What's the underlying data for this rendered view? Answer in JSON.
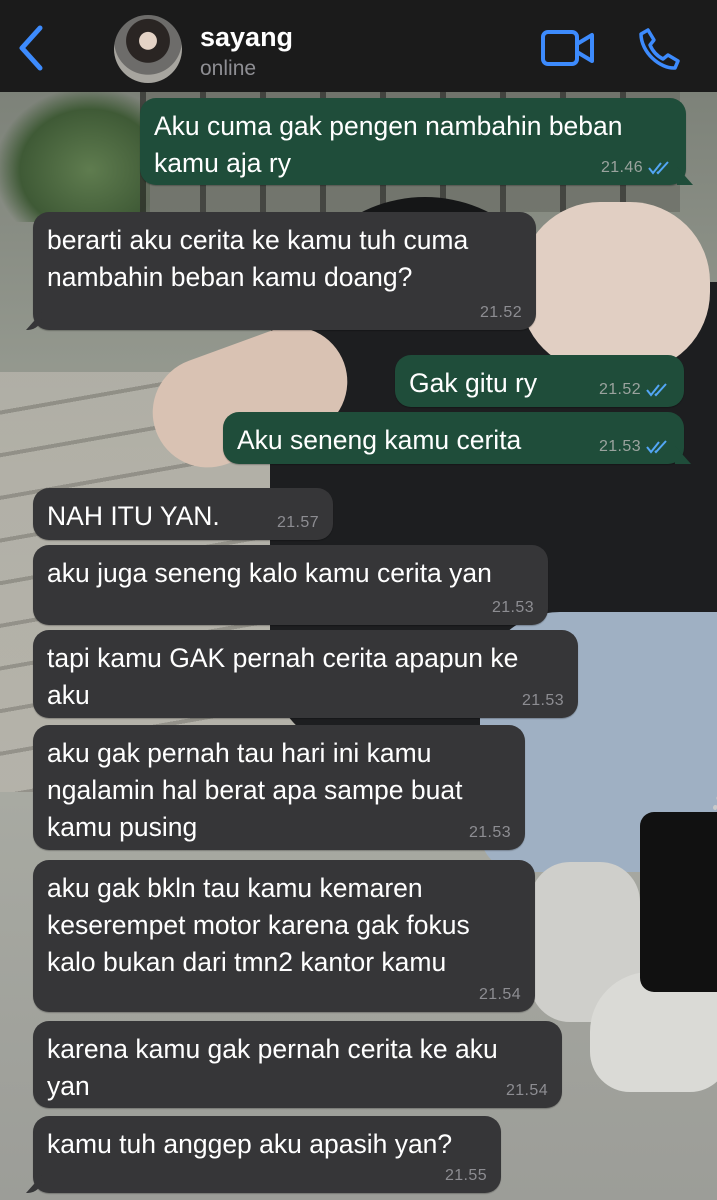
{
  "header": {
    "contact_name": "sayang",
    "contact_status": "online"
  },
  "colors": {
    "header_bg": "#1b1b1b",
    "accent": "#3d8bfd",
    "outgoing_bubble": "#1f4d3a",
    "incoming_bubble": "#363638",
    "read_ticks": "#53a6f5"
  },
  "icons": {
    "back": "chevron-left-icon",
    "video": "video-camera-icon",
    "call": "phone-icon",
    "read": "double-check-icon"
  },
  "messages": [
    {
      "direction": "out",
      "text": "Aku cuma gak pengen nambahin beban\nkamu aja ry",
      "time": "21.46",
      "read": true
    },
    {
      "direction": "in",
      "text": "berarti aku cerita ke kamu tuh cuma\nnambahin beban kamu doang?",
      "time": "21.52"
    },
    {
      "direction": "out",
      "text": "Gak gitu ry",
      "time": "21.52",
      "read": true
    },
    {
      "direction": "out",
      "text": "Aku seneng kamu cerita",
      "time": "21.53",
      "read": true
    },
    {
      "direction": "in",
      "text": "NAH ITU YAN.",
      "time": "21.57"
    },
    {
      "direction": "in",
      "text": "aku juga seneng kalo kamu cerita yan",
      "time": "21.53"
    },
    {
      "direction": "in",
      "text": "tapi kamu GAK pernah cerita apapun ke\naku",
      "time": "21.53"
    },
    {
      "direction": "in",
      "text": "aku gak pernah tau hari ini kamu\nngalamin hal berat apa sampe buat\nkamu pusing",
      "time": "21.53"
    },
    {
      "direction": "in",
      "text": "aku gak bkln tau kamu kemaren\nkeserempet motor karena gak fokus\nkalo bukan dari tmn2 kantor kamu",
      "time": "21.54"
    },
    {
      "direction": "in",
      "text": "karena kamu gak pernah cerita ke aku\nyan",
      "time": "21.54"
    },
    {
      "direction": "in",
      "text": "kamu tuh anggep aku apasih yan?",
      "time": "21.55"
    }
  ]
}
